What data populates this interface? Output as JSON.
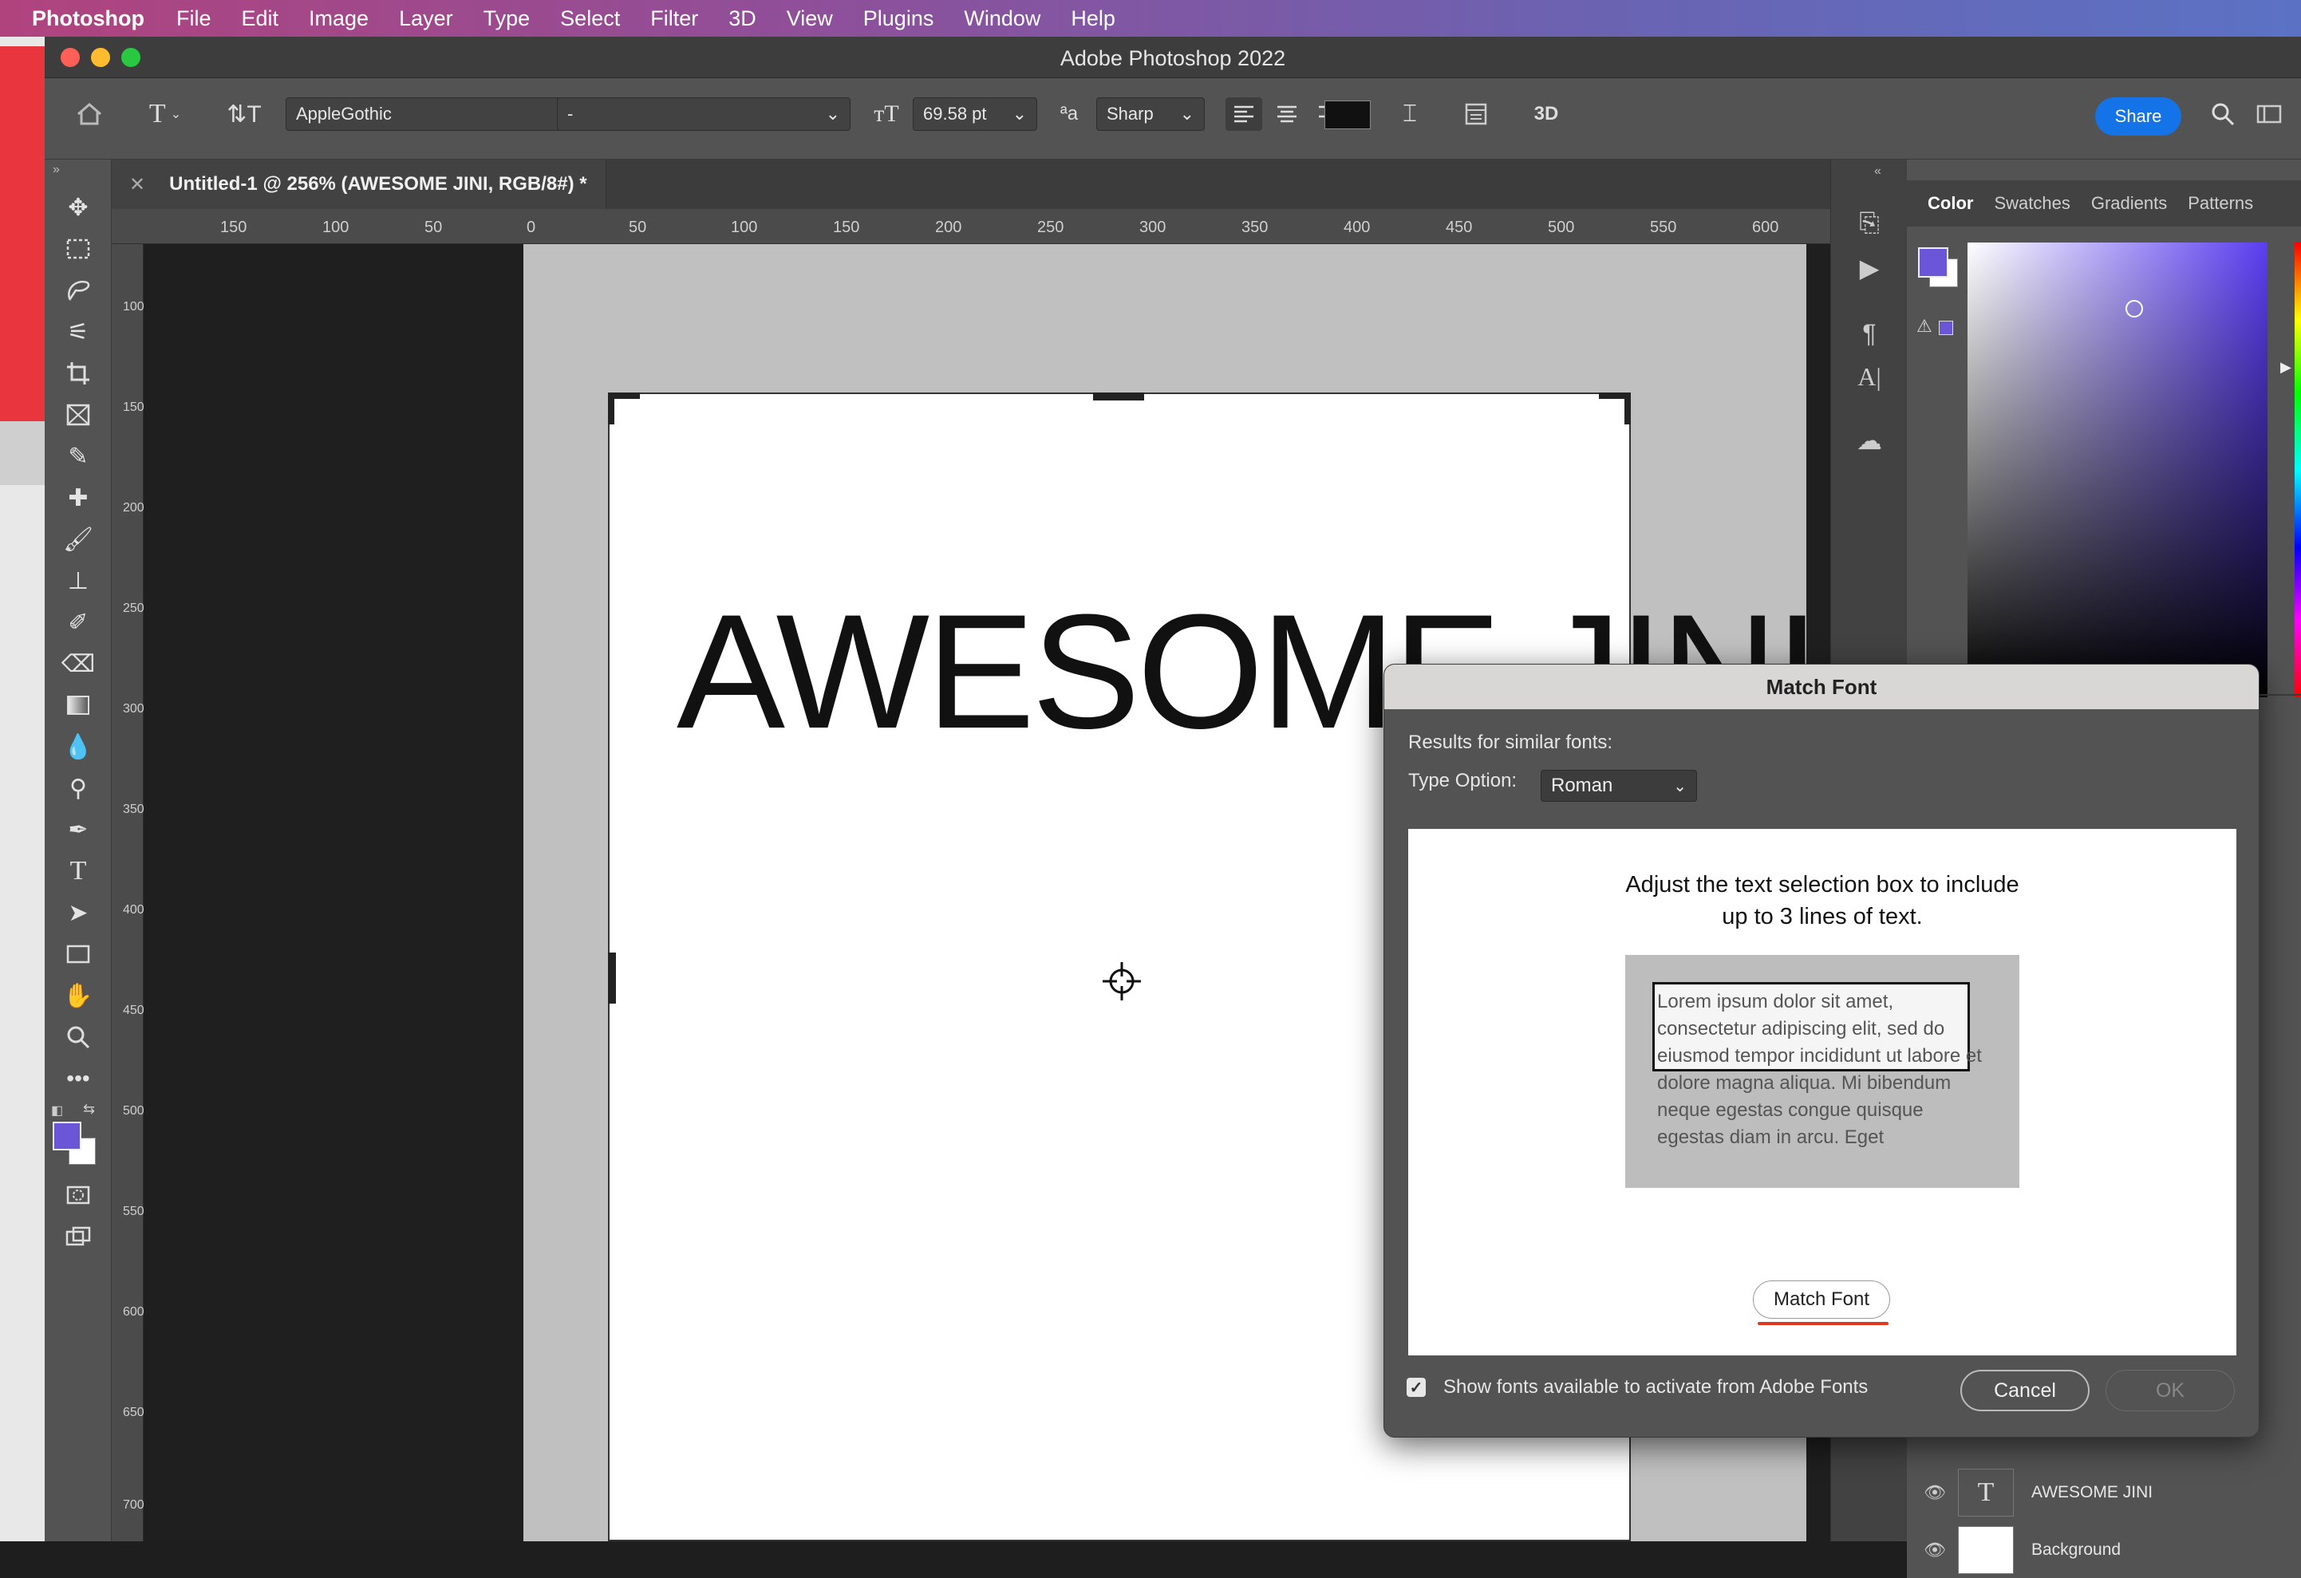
{
  "menubar": {
    "app": "Photoshop",
    "items": [
      "File",
      "Edit",
      "Image",
      "Layer",
      "Type",
      "Select",
      "Filter",
      "3D",
      "View",
      "Plugins",
      "Window",
      "Help"
    ]
  },
  "window": {
    "title": "Adobe Photoshop 2022"
  },
  "options": {
    "font_family": "AppleGothic",
    "font_style": "-",
    "font_size": "69.58 pt",
    "aa_label": "ªa",
    "antialias": "Sharp",
    "three_d": "3D",
    "share": "Share",
    "text_color": "#111111"
  },
  "document": {
    "tab_name": "Untitled-1 @ 256% (AWESOME JINI, RGB/8#) *",
    "canvas_text": "AWESOME JINI"
  },
  "ruler": {
    "h_labels": [
      "150",
      "100",
      "50",
      "0",
      "50",
      "100",
      "150",
      "200",
      "250",
      "300",
      "350",
      "400",
      "450",
      "500",
      "550",
      "600"
    ],
    "v_labels": [
      "100",
      "150",
      "200",
      "250",
      "300",
      "350",
      "400",
      "450",
      "500",
      "550",
      "600",
      "650",
      "700"
    ]
  },
  "color_panel": {
    "tabs": [
      "Color",
      "Swatches",
      "Gradients",
      "Patterns"
    ],
    "foreground": "#6a56d6",
    "background": "#ffffff"
  },
  "layers": [
    {
      "name": "AWESOME JINI",
      "type": "text"
    },
    {
      "name": "Background",
      "type": "image",
      "locked": true
    }
  ],
  "dialog": {
    "title": "Match Font",
    "results_label": "Results for similar fonts:",
    "type_option_label": "Type Option:",
    "type_option_value": "Roman",
    "instruction_line1": "Adjust the text selection box to include",
    "instruction_line2": "up to 3 lines of text.",
    "sample_text": "Lorem ipsum dolor sit amet, consectetur adipiscing elit, sed do eiusmod tempor incididunt ut labore et dolore magna aliqua. Mi bibendum neque egestas congue quisque egestas diam in arcu. Eget",
    "match_button": "Match Font",
    "checkbox_label": "Show fonts available to activate from Adobe Fonts",
    "checkbox_checked": true,
    "cancel": "Cancel",
    "ok": "OK"
  }
}
